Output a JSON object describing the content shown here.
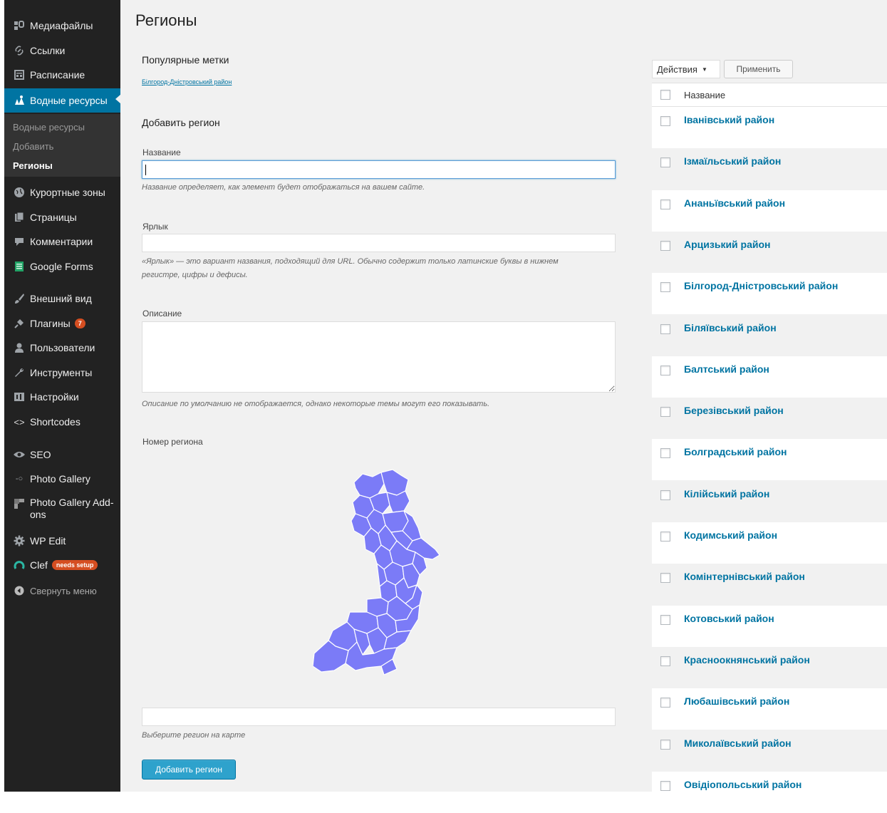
{
  "sidebar": {
    "items": [
      {
        "label": "Медиафайлы",
        "icon": "media-icon"
      },
      {
        "label": "Ссылки",
        "icon": "link-icon"
      },
      {
        "label": "Расписание",
        "icon": "calendar-icon"
      },
      {
        "label": "Водные ресурсы",
        "icon": "water-icon"
      },
      {
        "label": "Курортные зоны",
        "icon": "globe-icon"
      },
      {
        "label": "Страницы",
        "icon": "pages-icon"
      },
      {
        "label": "Комментарии",
        "icon": "comment-icon"
      },
      {
        "label": "Google Forms",
        "icon": "forms-icon"
      },
      {
        "label": "Внешний вид",
        "icon": "brush-icon"
      },
      {
        "label": "Плагины",
        "icon": "plugin-icon",
        "badge": "7"
      },
      {
        "label": "Пользователи",
        "icon": "user-icon"
      },
      {
        "label": "Инструменты",
        "icon": "wrench-icon"
      },
      {
        "label": "Настройки",
        "icon": "settings-icon"
      },
      {
        "label": "Shortcodes",
        "icon": "code-icon"
      },
      {
        "label": "SEO",
        "icon": "seo-icon"
      },
      {
        "label": "Photo Gallery",
        "icon": "gallery-icon"
      },
      {
        "label": "Photo Gallery Add-ons",
        "icon": "gallery-addons-icon"
      },
      {
        "label": "WP Edit",
        "icon": "gear-icon"
      },
      {
        "label": "Clef",
        "icon": "clef-icon",
        "badge": "needs setup"
      },
      {
        "label": "Свернуть меню",
        "icon": "collapse-icon"
      }
    ],
    "submenu": [
      "Водные ресурсы",
      "Добавить",
      "Регионы"
    ]
  },
  "page": {
    "title": "Регионы",
    "popular_tags_heading": "Популярные метки",
    "popular_tag_link": "Білгород-Дністровський район",
    "add_heading": "Добавить регион",
    "name_label": "Название",
    "name_value": "",
    "name_help": "Название определяет, как элемент будет отображаться на вашем сайте.",
    "slug_label": "Ярлык",
    "slug_value": "",
    "slug_help_line1": "«Ярлык» — это вариант названия, подходящий для URL. Обычно содержит только латинские буквы в нижнем",
    "slug_help_line2": "регистре, цифры и дефисы.",
    "desc_label": "Описание",
    "desc_help": "Описание по умолчанию не отображается, однако некоторые темы могут его показывать.",
    "region_number_label": "Номер региона",
    "region_number_value": "",
    "region_help": "Выберите регион на карте",
    "submit_label": "Добавить регион",
    "map_color": "#7b7bf7"
  },
  "list": {
    "bulk_action": "Действия",
    "apply_label": "Применить",
    "column_name": "Название",
    "rows": [
      "Іванівський район",
      "Ізмаїльський район",
      "Ананьївський район",
      "Арцизький район",
      "Білгород-Дністровський район",
      "Біляївський район",
      "Балтський район",
      "Березівський район",
      "Болградський район",
      "Кілійський район",
      "Кодимський район",
      "Комінтернівський район",
      "Котовський район",
      "Красноокнянський район",
      "Любашівський район",
      "Миколаївський район",
      "Овідіопольський район"
    ]
  },
  "colors": {
    "sidebar_bg": "#222222",
    "active_menu": "#0074a2",
    "link": "#0074a2",
    "primary_button": "#2ea2cc",
    "badge": "#d54e21"
  }
}
